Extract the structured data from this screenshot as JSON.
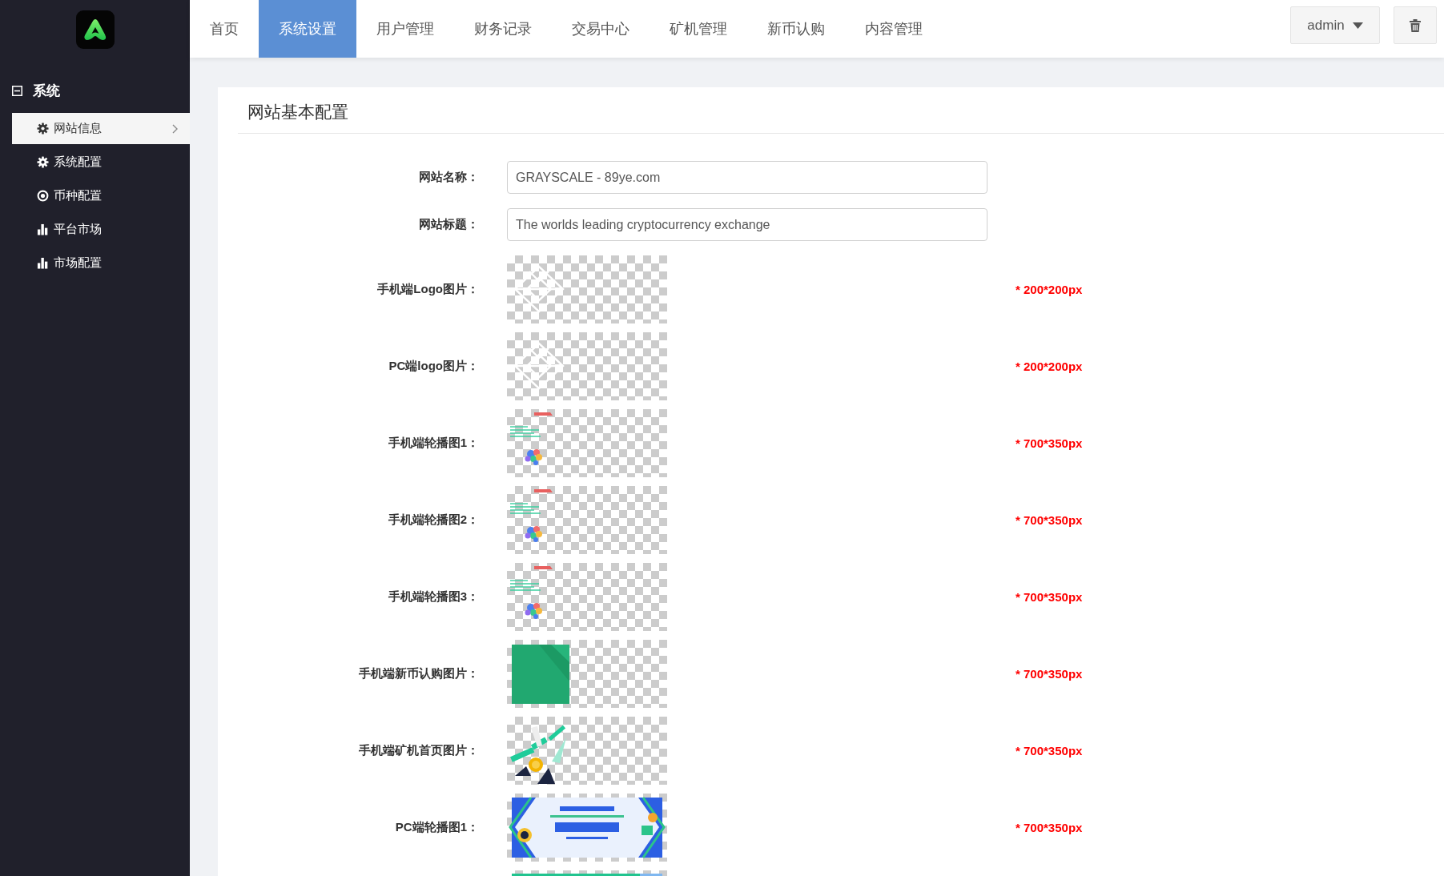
{
  "sidebar": {
    "groups": [
      {
        "title": "系统",
        "expanded": true,
        "items": [
          {
            "label": "网站信息",
            "kind": "settings",
            "selected": true
          },
          {
            "label": "系统配置",
            "kind": "settings",
            "selected": false
          },
          {
            "label": "币种配置",
            "kind": "currency",
            "selected": false
          },
          {
            "label": "平台市场",
            "kind": "market",
            "selected": false
          },
          {
            "label": "市场配置",
            "kind": "market",
            "selected": false
          }
        ]
      }
    ]
  },
  "nav": {
    "tabs": [
      {
        "label": "首页",
        "selected": false
      },
      {
        "label": "系统设置",
        "selected": true
      },
      {
        "label": "用户管理",
        "selected": false
      },
      {
        "label": "财务记录",
        "selected": false
      },
      {
        "label": "交易中心",
        "selected": false
      },
      {
        "label": "矿机管理",
        "selected": false
      },
      {
        "label": "新币认购",
        "selected": false
      },
      {
        "label": "内容管理",
        "selected": false
      }
    ],
    "user_menu": {
      "label": "admin"
    }
  },
  "panel": {
    "title": "网站基本配置",
    "fields": [
      {
        "kind": "text",
        "label": "网站名称：",
        "value": "GRAYSCALE - 89ye.com"
      },
      {
        "kind": "text",
        "label": "网站标题：",
        "value": "The worlds leading cryptocurrency exchange"
      },
      {
        "kind": "logo",
        "label": "手机端Logo图片：",
        "hint": "* 200*200px"
      },
      {
        "kind": "logo",
        "label": "PC端logo图片：",
        "hint": "* 200*200px"
      },
      {
        "kind": "carousel",
        "label": "手机端轮播图1：",
        "hint": "* 700*350px"
      },
      {
        "kind": "carousel",
        "label": "手机端轮播图2：",
        "hint": "* 700*350px"
      },
      {
        "kind": "carousel",
        "label": "手机端轮播图3：",
        "hint": "* 700*350px"
      },
      {
        "kind": "tile",
        "label": "手机端新币认购图片：",
        "hint": "* 700*350px"
      },
      {
        "kind": "mining",
        "label": "手机端矿机首页图片：",
        "hint": "* 700*350px"
      },
      {
        "kind": "banner",
        "label": "PC端轮播图1：",
        "hint": "* 700*350px"
      },
      {
        "kind": "strip"
      }
    ]
  }
}
